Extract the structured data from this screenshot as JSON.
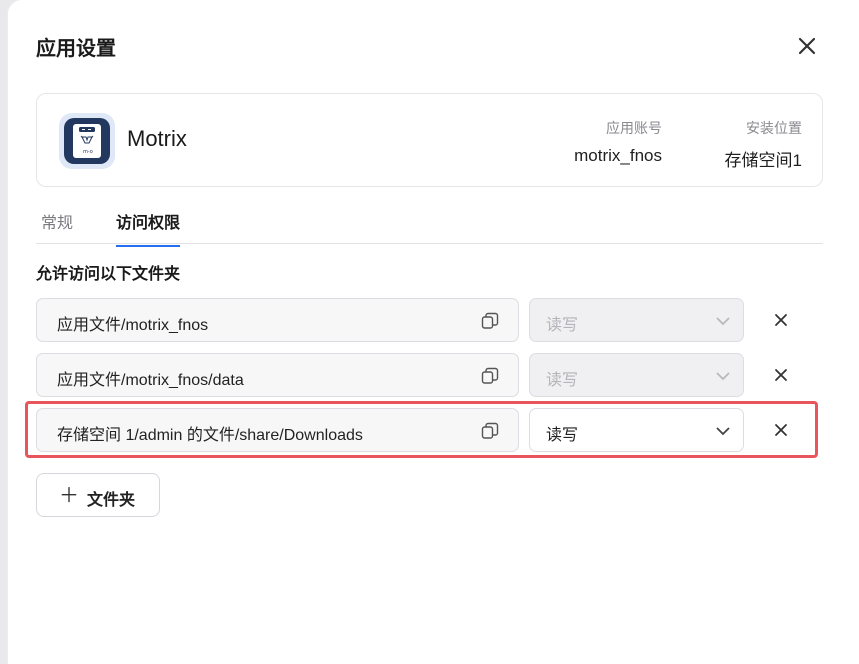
{
  "dialog": {
    "title": "应用设置",
    "close_icon": "close-icon"
  },
  "app": {
    "name": "Motrix",
    "icon": "motrix-app-icon",
    "account_label": "应用账号",
    "account_value": "motrix_fnos",
    "location_label": "安装位置",
    "location_value": "存储空间1"
  },
  "tabs": [
    {
      "label": "常规",
      "active": false
    },
    {
      "label": "访问权限",
      "active": true
    }
  ],
  "access": {
    "section_title": "允许访问以下文件夹",
    "folders": [
      {
        "path": "应用文件/motrix_fnos",
        "permission": "读写",
        "disabled": true
      },
      {
        "path": "应用文件/motrix_fnos/data",
        "permission": "读写",
        "disabled": true
      },
      {
        "path": "存储空间 1/admin 的文件/share/Downloads",
        "permission": "读写",
        "disabled": false
      }
    ],
    "add_button_label": "文件夹"
  },
  "colors": {
    "accent": "#2a6ef0",
    "highlight": "#e8555c",
    "app_icon_dark": "#22385e"
  }
}
